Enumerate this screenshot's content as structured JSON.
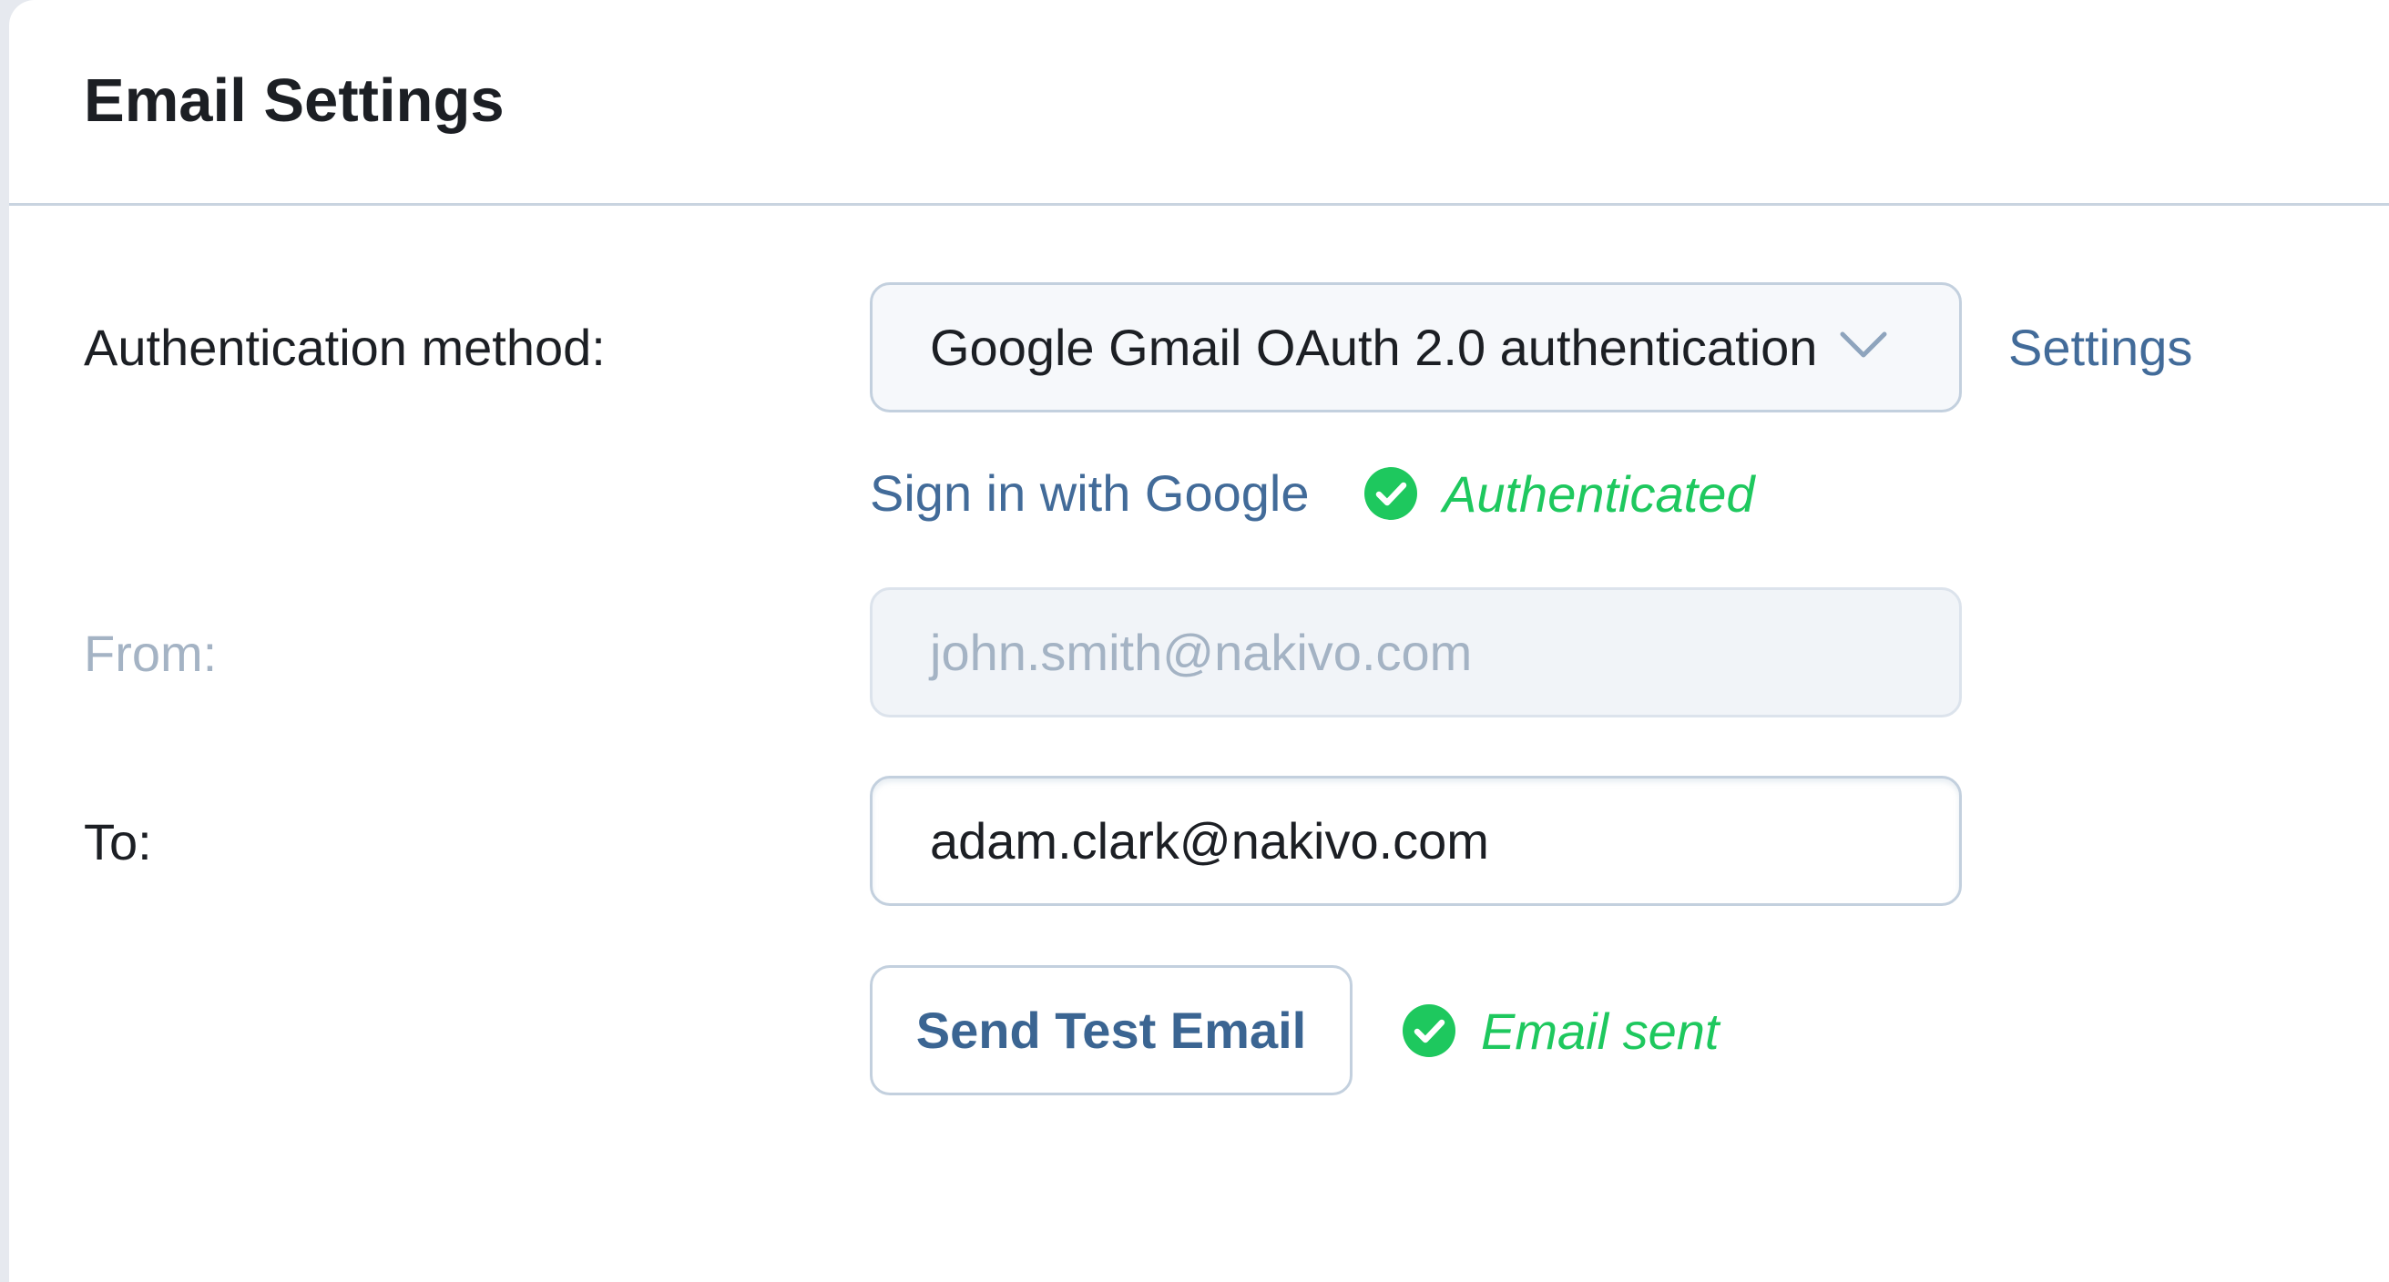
{
  "title": "Email Settings",
  "auth": {
    "label": "Authentication method:",
    "selected": "Google Gmail OAuth 2.0 authentication",
    "settings_link": "Settings",
    "sign_in_link": "Sign in with Google",
    "status": "Authenticated"
  },
  "from": {
    "label": "From:",
    "value": "john.smith@nakivo.com"
  },
  "to": {
    "label": "To:",
    "value": "adam.clark@nakivo.com"
  },
  "test": {
    "button_label": "Send Test Email",
    "status": "Email sent"
  },
  "colors": {
    "link": "#426b99",
    "success": "#1ec85e",
    "border": "#c3d0de",
    "disabled_text": "#a4b3c4"
  }
}
